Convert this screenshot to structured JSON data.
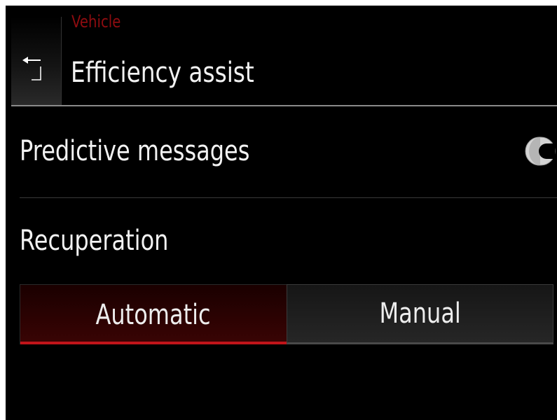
{
  "header": {
    "breadcrumb": "Vehicle",
    "title": "Efficiency assist",
    "back_icon": "back-arrow-icon"
  },
  "settings": {
    "predictive_messages": {
      "label": "Predictive messages",
      "toggle_on": false
    },
    "recuperation": {
      "label": "Recuperation",
      "options": [
        "Automatic",
        "Manual"
      ],
      "selected": "Automatic"
    }
  },
  "colors": {
    "accent": "#c1141a",
    "breadcrumb": "#8e0c10",
    "background": "#000000",
    "text": "#f2f2f2"
  }
}
